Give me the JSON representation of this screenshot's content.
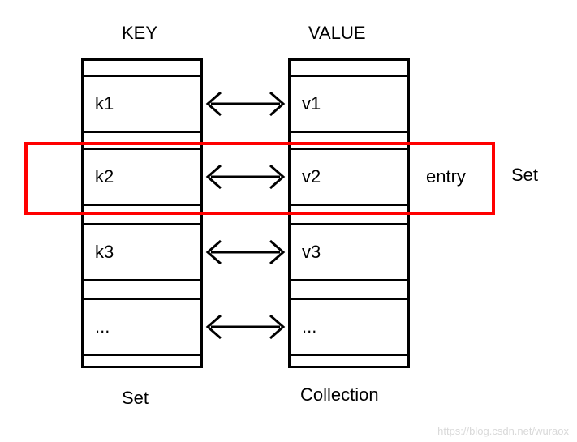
{
  "headers": {
    "key": "KEY",
    "value": "VALUE"
  },
  "keys": [
    "k1",
    "k2",
    "k3",
    "..."
  ],
  "values": [
    "v1",
    "v2",
    "v3",
    "..."
  ],
  "footers": {
    "keySet": "Set",
    "valueCollection": "Collection"
  },
  "highlight": {
    "entry": "entry",
    "setLabel": "Set"
  },
  "watermark": "https://blog.csdn.net/wuraox"
}
